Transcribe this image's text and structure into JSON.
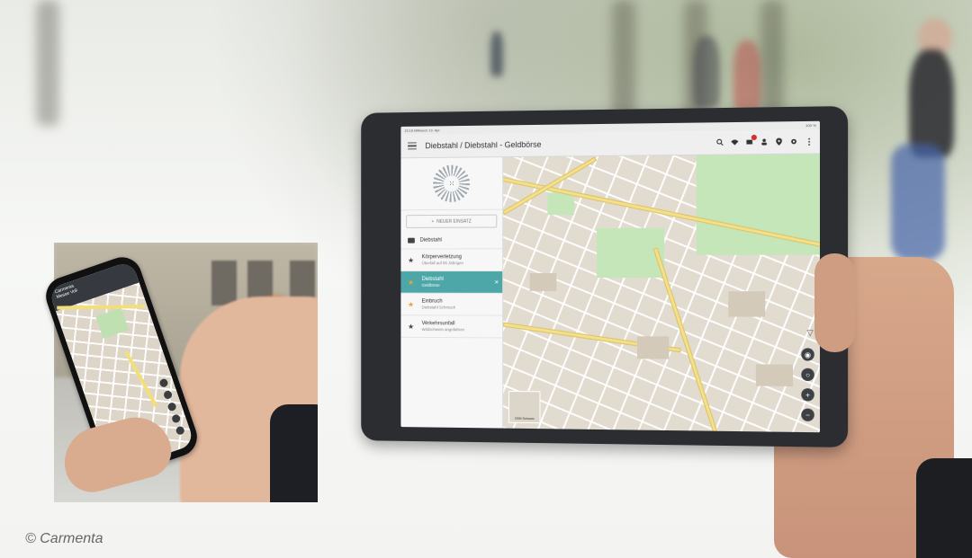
{
  "credit": "© Carmenta",
  "tablet": {
    "status_time": "15:18",
    "status_date": "Mittwoch 13. Apr.",
    "status_right": "100 %",
    "app_title": "Diebstahl / Diebstahl - Geldbörse",
    "toolbar_icons": [
      "search-icon",
      "wifi-icon",
      "messages-icon",
      "user-icon",
      "location-icon",
      "settings-icon",
      "more-icon"
    ],
    "new_button_label": "NEUER EINSATZ",
    "group_label": "Diebstahl",
    "items": [
      {
        "title": "Körperverletzung",
        "sub": "Überfall auf 85 Jährigen",
        "active": false
      },
      {
        "title": "Diebstahl",
        "sub": "Geldbörse",
        "active": true
      },
      {
        "title": "Einbruch",
        "sub": "Diebstahl Schmuck",
        "active": false
      },
      {
        "title": "Verkehrsunfall",
        "sub": "Wildschwein angefahren",
        "active": false
      }
    ],
    "minimap_label": "OSM Schwarz",
    "accent_color": "#4da7a8",
    "badge_color": "#d32f2f"
  },
  "phone": {
    "title_line1": "Carmenta",
    "title_line2": "Messe Voll"
  }
}
